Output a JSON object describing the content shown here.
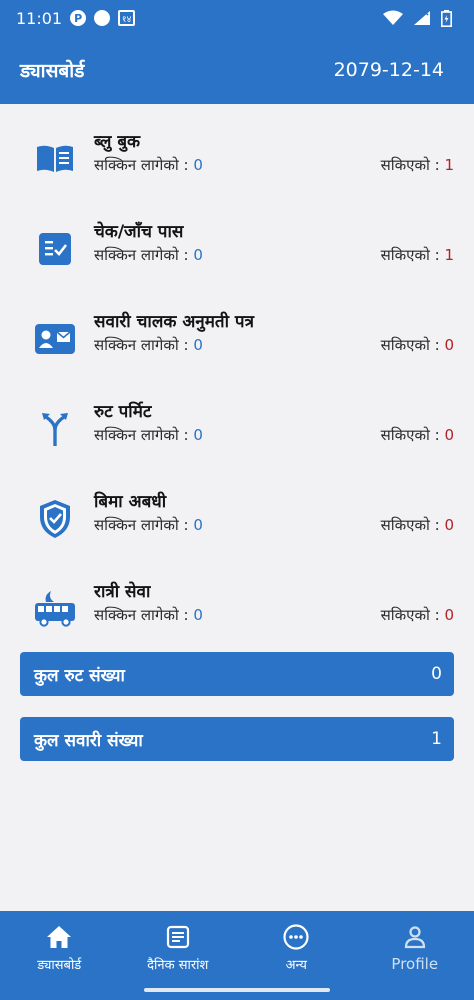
{
  "status": {
    "time": "11:01",
    "p_icon": "P",
    "num_badge": "१४"
  },
  "header": {
    "title": "ड्यासबोर्ड",
    "date": "2079-12-14"
  },
  "items": [
    {
      "name": "ब्लु बुक",
      "pending_label": "सक्किन लागेको : ",
      "pending_value": "0",
      "done_label": "सकिएको : ",
      "done_value": "1",
      "icon": "book-icon"
    },
    {
      "name": "चेक/जाँच पास",
      "pending_label": "सक्किन लागेको : ",
      "pending_value": "0",
      "done_label": "सकिएको : ",
      "done_value": "1",
      "icon": "checklist-icon"
    },
    {
      "name": "सवारी चालक अनुमती पत्र",
      "pending_label": "सक्किन लागेको : ",
      "pending_value": "0",
      "done_label": "सकिएको : ",
      "done_value": "0",
      "icon": "id-card-icon"
    },
    {
      "name": "रुट पर्मिट",
      "pending_label": "सक्किन लागेको : ",
      "pending_value": "0",
      "done_label": "सकिएको : ",
      "done_value": "0",
      "icon": "route-split-icon"
    },
    {
      "name": "बिमा अबधी",
      "pending_label": "सक्किन लागेको : ",
      "pending_value": "0",
      "done_label": "सकिएको : ",
      "done_value": "0",
      "icon": "shield-check-icon"
    },
    {
      "name": "रात्री सेवा",
      "pending_label": "सक्किन लागेको : ",
      "pending_value": "0",
      "done_label": "सकिएको : ",
      "done_value": "0",
      "icon": "night-bus-icon"
    }
  ],
  "totals": [
    {
      "label": "कुल रुट संख्या",
      "value": "0"
    },
    {
      "label": "कुल सवारी संख्या",
      "value": "1"
    }
  ],
  "nav": [
    {
      "label": "ड्यासबोर्ड",
      "icon": "home-icon"
    },
    {
      "label": "दैनिक सारांश",
      "icon": "document-icon"
    },
    {
      "label": "अन्य",
      "icon": "more-icon"
    },
    {
      "label": "Profile",
      "icon": "person-icon"
    }
  ],
  "colors": {
    "primary": "#2a73c6",
    "background": "#f2f1f3",
    "done_value": "#b3222a"
  }
}
